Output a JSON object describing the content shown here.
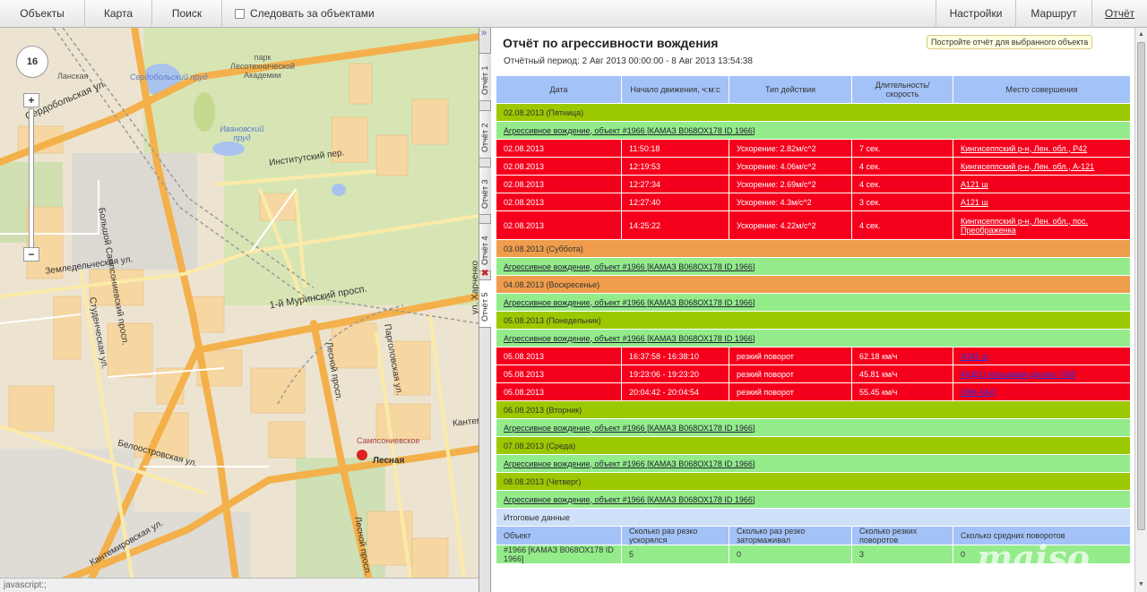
{
  "toolbar": {
    "objects": "Объекты",
    "map": "Карта",
    "search": "Поиск",
    "follow": "Следовать за объектами",
    "settings": "Настройки",
    "route": "Маршрут",
    "report": "Отчёт"
  },
  "map": {
    "zoom": "16",
    "labels": {
      "sevastopolskaya": "Сердобольская ул.",
      "lansk": "Ланская",
      "park": "парк Лесотехнической Академии",
      "serd_pond": "Сердобольский пруд",
      "ivan_pond": "Ивановский пруд",
      "institutsky": "Институтский пер.",
      "zemledel": "Земледельческая ул.",
      "bsamp": "Большой Сампсониевский просп.",
      "studench": "Студенческая ул.",
      "murinsky": "1-й Муринский просп.",
      "lesnoy": "Лесной просп.",
      "parg": "Парголовская ул.",
      "kharchenko": "ул. Харченко",
      "beloostr": "Белоостровская ул.",
      "kantemir": "Кантемировская ул.",
      "kantem2": "Кантем",
      "lesnaya": "Лесная",
      "samps": "Сампсониевское",
      "lesnoy2": "Лесной просп."
    },
    "status": "javascript:;"
  },
  "tabs": [
    "Отчёт 1",
    "Отчёт 2",
    "Отчёт 3",
    "Отчёт 4",
    "Отчёт 5"
  ],
  "report": {
    "title": "Отчёт по агрессивности вождения",
    "period": "Отчётный период: 2 Авг 2013 00:00:00 - 8 Авг 2013 13:54:38",
    "hint": "Постройте отчёт для выбранного объекта",
    "headers": [
      "Дата",
      "Начало движения, ч:м:с",
      "Тип действия",
      "Длительность/ скорость",
      "Место совершения"
    ],
    "rows": [
      {
        "type": "day",
        "cls": "yel",
        "text": "02.08.2013 (Пятница)"
      },
      {
        "type": "obj",
        "text": "Агрессивное вождение, объект #1966 [КАМАЗ В068ОХ178 ID 1966]"
      },
      {
        "type": "ev",
        "cells": [
          "02.08.2013",
          "11:50:18",
          "Ускорение: 2.82м/с^2",
          "7 сек.",
          "Кингисеппский р-н, Лен. обл., Р42"
        ]
      },
      {
        "type": "ev",
        "cells": [
          "02.08.2013",
          "12:19:53",
          "Ускорение: 4.06м/с^2",
          "4 сек.",
          "Кингисеппский р-н, Лен. обл., А-121"
        ]
      },
      {
        "type": "ev",
        "cells": [
          "02.08.2013",
          "12:27:34",
          "Ускорение: 2.69м/с^2",
          "4 сек.",
          "А121 ш"
        ]
      },
      {
        "type": "ev",
        "cells": [
          "02.08.2013",
          "12:27:40",
          "Ускорение: 4.3м/с^2",
          "3 сек.",
          "А121 ш"
        ]
      },
      {
        "type": "ev2",
        "cells": [
          "02.08.2013",
          "14:25:22",
          "Ускорение: 4.22м/с^2",
          "4 сек.",
          "Кингисеппский р-н, Лен. обл., пос. Преображенка"
        ]
      },
      {
        "type": "day",
        "cls": "org",
        "text": "03.08.2013 (Суббота)"
      },
      {
        "type": "obj",
        "text": "Агрессивное вождение, объект #1966 [КАМАЗ В068ОХ178 ID 1966]"
      },
      {
        "type": "day",
        "cls": "org",
        "text": "04.08.2013 (Воскресенье)"
      },
      {
        "type": "obj",
        "text": "Агрессивное вождение, объект #1966 [КАМАЗ В068ОХ178 ID 1966]"
      },
      {
        "type": "day",
        "cls": "yel",
        "text": "05.08.2013 (Понедельник)"
      },
      {
        "type": "obj",
        "text": "Агрессивное вождение, объект #1966 [КАМАЗ В068ОХ178 ID 1966]"
      },
      {
        "type": "evl",
        "cells": [
          "05.08.2013",
          "16:37:58 - 16:38:10",
          "резкий поворот",
          "62.18 км/ч",
          "А181 ш"
        ]
      },
      {
        "type": "evl",
        "cells": [
          "05.08.2013",
          "19:23:06 - 19:23:20",
          "резкий поворот",
          "45.81 км/ч",
          "КАД(1) кольцевая дорога / 008"
        ]
      },
      {
        "type": "evl",
        "cells": [
          "05.08.2013",
          "20:04:42 - 20:04:54",
          "резкий поворот",
          "55.45 км/ч",
          "ОВК-КАД"
        ]
      },
      {
        "type": "day",
        "cls": "yel",
        "text": "06.08.2013 (Вторник)"
      },
      {
        "type": "obj",
        "text": "Агрессивное вождение, объект #1966 [КАМАЗ В068ОХ178 ID 1966]"
      },
      {
        "type": "day",
        "cls": "yel",
        "text": "07.08.2013 (Среда)"
      },
      {
        "type": "obj",
        "text": "Агрессивное вождение, объект #1966 [КАМАЗ В068ОХ178 ID 1966]"
      },
      {
        "type": "day",
        "cls": "yel",
        "text": "08.08.2013 (Четверг)"
      },
      {
        "type": "obj",
        "text": "Агрессивное вождение, объект #1966 [КАМАЗ В068ОХ178 ID 1966]"
      }
    ],
    "summary_label": "Итоговые данные",
    "summary_headers": [
      "Объект",
      "Сколько раз резко ускорялся",
      "Сколько раз резко затормаживал",
      "Сколько резких поворотов",
      "Сколько средних поворотов"
    ],
    "summary_row": [
      "#1966 [КАМАЗ В068ОХ178 ID 1966]",
      "5",
      "0",
      "3",
      "0"
    ]
  },
  "watermark": "maiso"
}
